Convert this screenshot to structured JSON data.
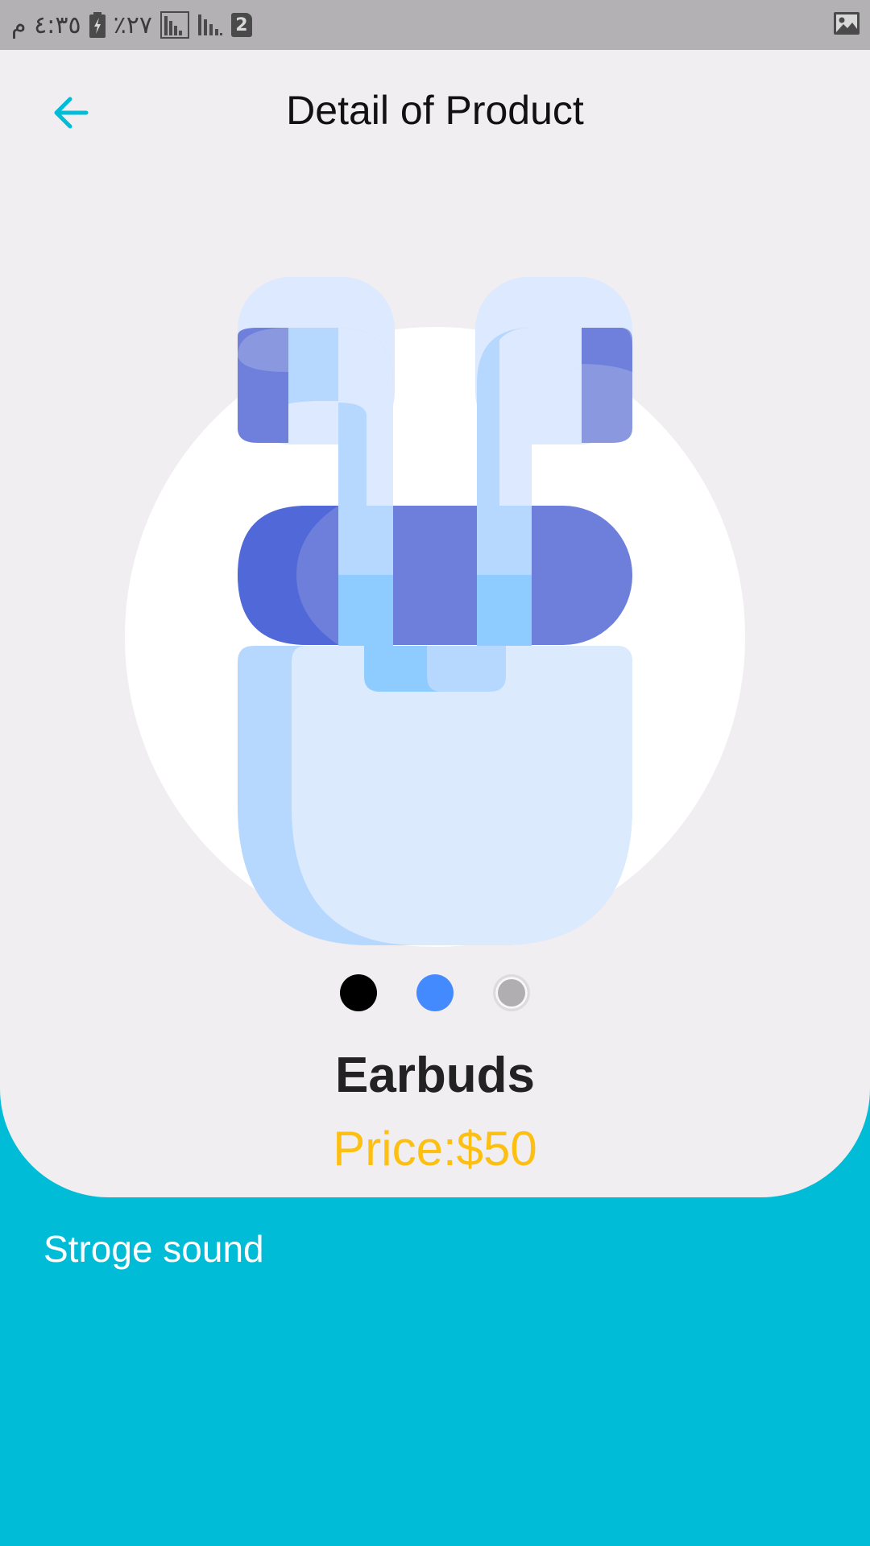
{
  "status_bar": {
    "time": "٤:٣٥ م",
    "battery_percent": "٪٢٧",
    "sim_slot": "2"
  },
  "header": {
    "title": "Detail of Product"
  },
  "product": {
    "name": "Earbuds",
    "price": "Price:$50",
    "description": "Stroge sound",
    "color_options": [
      {
        "name": "black",
        "hex": "#000000"
      },
      {
        "name": "blue",
        "hex": "#448aff"
      },
      {
        "name": "gray",
        "hex": "#b0aeb1"
      }
    ]
  },
  "colors": {
    "accent": "#00bcd6",
    "card_background": "#f1eef2",
    "price": "#fdc012",
    "status_bar": "#b3b1b4"
  }
}
